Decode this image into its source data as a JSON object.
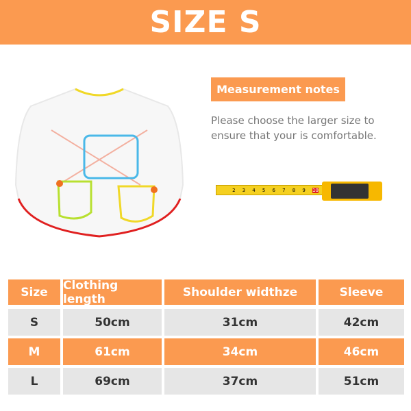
{
  "banner": {
    "title": "SIZE S"
  },
  "notes": {
    "label": "Measurement notes",
    "text": "Please choose the larger size to ensure that your is comfortable."
  },
  "tape": {
    "numbers": [
      "2",
      "3",
      "4",
      "5",
      "6",
      "7",
      "8",
      "9",
      "10",
      "11"
    ]
  },
  "colors": {
    "accent": "#fb9a50",
    "row": "#e6e6e6"
  },
  "table": {
    "headers": [
      "Size",
      "Clothing length",
      "Shoulder widthze",
      "Sleeve"
    ],
    "rows": [
      [
        "S",
        "50cm",
        "31cm",
        "42cm"
      ],
      [
        "M",
        "61cm",
        "34cm",
        "46cm"
      ],
      [
        "L",
        "69cm",
        "37cm",
        "51cm"
      ]
    ]
  }
}
